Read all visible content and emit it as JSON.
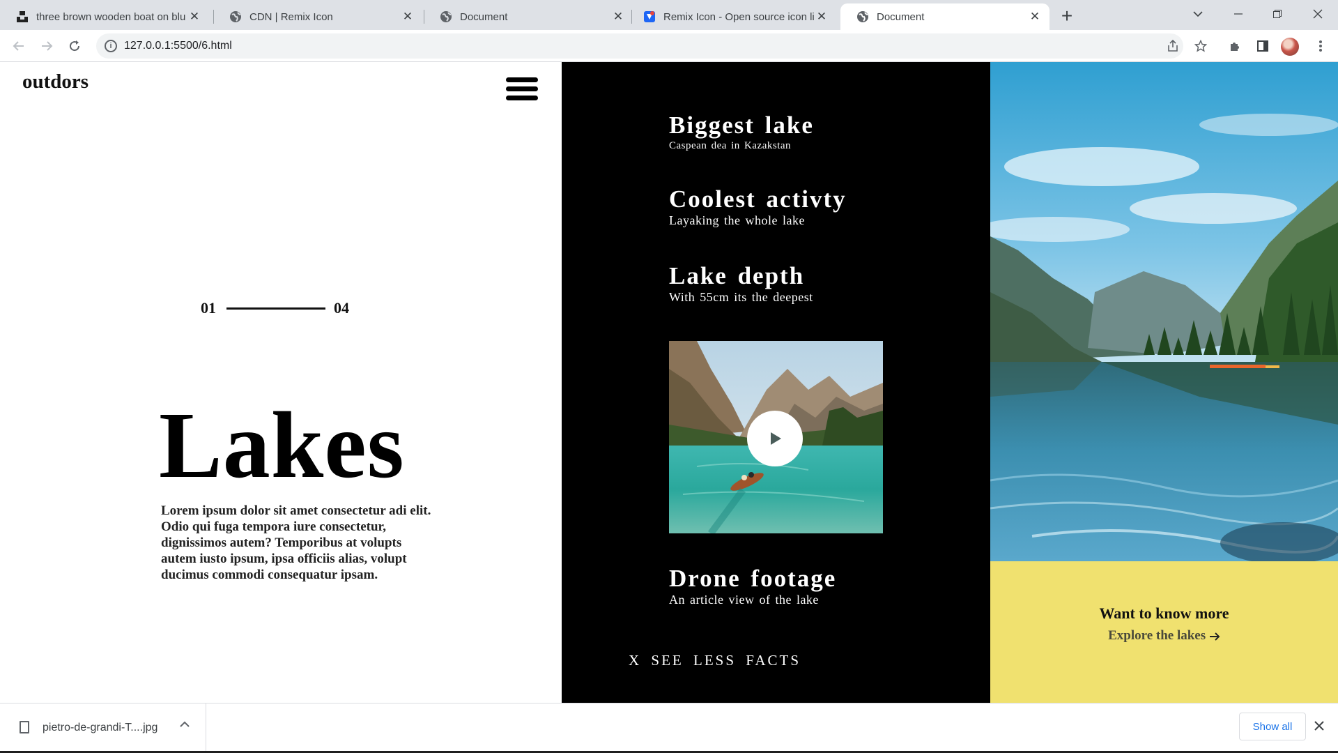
{
  "browser": {
    "tabs": [
      {
        "title": "three brown wooden boat on blu",
        "icon": "unsplash-icon",
        "active": false
      },
      {
        "title": "CDN | Remix Icon",
        "icon": "globe-icon",
        "active": false
      },
      {
        "title": "Document",
        "icon": "globe-icon",
        "active": false
      },
      {
        "title": "Remix Icon - Open source icon lib",
        "icon": "remixicon-icon",
        "active": false
      },
      {
        "title": "Document",
        "icon": "globe-icon",
        "active": true
      }
    ],
    "url": "127.0.0.1:5500/6.html"
  },
  "site": {
    "logo": "outdors",
    "counter": {
      "current": "01",
      "total": "04"
    },
    "hero": {
      "title": "Lakes",
      "text": "Lorem ipsum dolor sit amet consectetur adi elit. Odio qui fuga tempora iure consectetur, dignissimos autem? Temporibus at volupts autem iusto ipsum, ipsa officiis alias, volupt ducimus commodi consequatur ipsam."
    },
    "facts": [
      {
        "title": "Biggest lake",
        "subtitle": "Caspean dea in Kazakstan"
      },
      {
        "title": "Coolest activty",
        "subtitle": "Layaking the whole lake"
      },
      {
        "title": "Lake depth",
        "subtitle": "With 55cm its the deepest"
      },
      {
        "title": "Drone footage",
        "subtitle": "An article view of the lake"
      }
    ],
    "see_less": "X SEE LESS FACTS",
    "cta": {
      "title": "Want to know more",
      "link": "Explore the lakes"
    },
    "colors": {
      "dark_panel": "#000000",
      "cta_background": "#f0e16f"
    }
  },
  "downloads": {
    "file_name": "pietro-de-grandi-T....jpg",
    "show_all": "Show all"
  }
}
